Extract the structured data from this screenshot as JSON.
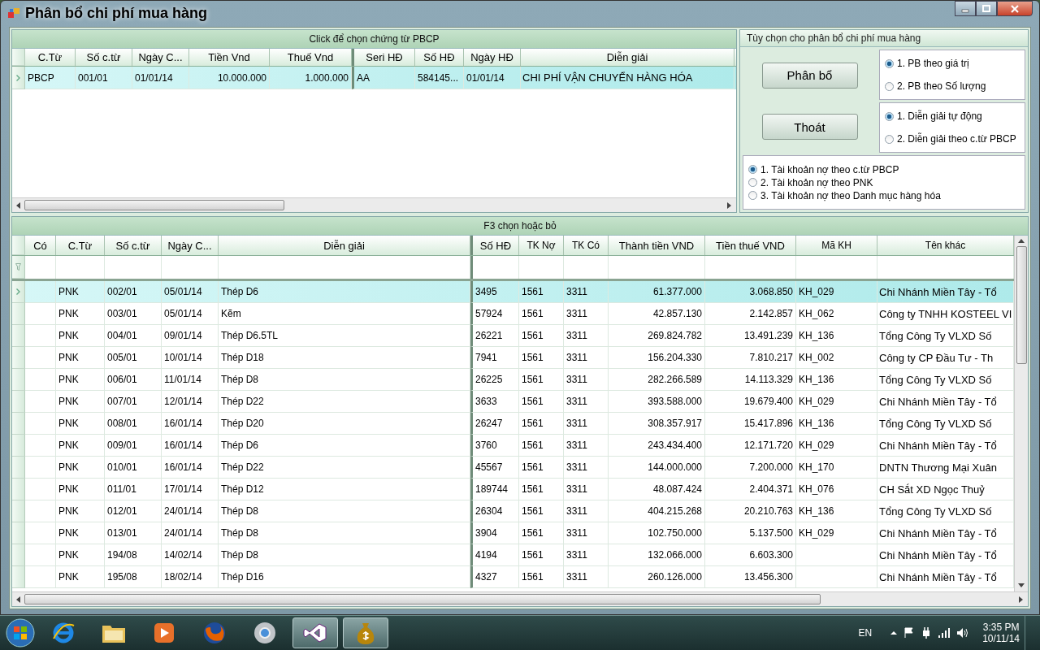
{
  "window": {
    "title": "Phân bổ chi phí mua hàng"
  },
  "top_grid": {
    "caption": "Click để chọn chứng từ PBCP",
    "columns": [
      "C.Từ",
      "Số c.từ",
      "Ngày C...",
      "Tiền Vnd",
      "Thuế Vnd",
      "Seri HĐ",
      "Số HĐ",
      "Ngày HĐ",
      "Diễn giải"
    ],
    "rows": [
      {
        "selected": true,
        "cells": [
          "PBCP",
          "001/01",
          "01/01/14",
          "10.000.000",
          "1.000.000",
          "AA",
          "584145...",
          "01/01/14",
          "CHI PHÍ VẬN CHUYỂN HÀNG HÓA"
        ]
      }
    ]
  },
  "options": {
    "title": "Tùy chọn cho phân bổ chi phí mua hàng",
    "buttons": [
      "Phân bổ",
      "Thoát"
    ],
    "allocation": [
      {
        "label": "1. PB theo giá trị",
        "selected": true
      },
      {
        "label": "2. PB theo Số lượng",
        "selected": false
      }
    ],
    "description": [
      {
        "label": "1. Diễn giải tự động",
        "selected": true
      },
      {
        "label": "2. Diễn giải theo c.từ PBCP",
        "selected": false
      }
    ],
    "debit_account": [
      {
        "label": "1. Tài khoản nợ theo c.từ PBCP",
        "selected": true
      },
      {
        "label": "2. Tài khoản nợ theo PNK",
        "selected": false
      },
      {
        "label": "3. Tài khoản nợ theo Danh mục hàng hóa",
        "selected": false
      }
    ]
  },
  "bottom_grid": {
    "caption": "F3 chọn hoặc bỏ",
    "columns": [
      "Có",
      "C.Từ",
      "Số c.từ",
      "Ngày C...",
      "Diễn giải",
      "Số HĐ",
      "TK Nợ",
      "TK Có",
      "Thành tiền VND",
      "Tiền thuế VND",
      "Mã KH",
      "Tên khác"
    ],
    "rows": [
      {
        "selected": true,
        "cells": [
          null,
          "PNK",
          "002/01",
          "05/01/14",
          "Thép D6",
          "3495",
          "1561",
          "3311",
          "61.377.000",
          "3.068.850",
          "KH_029",
          "Chi Nhánh Miền Tây - Tổ"
        ]
      },
      {
        "selected": false,
        "cells": [
          null,
          "PNK",
          "003/01",
          "05/01/14",
          "Kẽm",
          "57924",
          "1561",
          "3311",
          "42.857.130",
          "2.142.857",
          "KH_062",
          "Công ty TNHH KOSTEEL VI"
        ]
      },
      {
        "selected": false,
        "cells": [
          null,
          "PNK",
          "004/01",
          "09/01/14",
          "Thép D6.5TL",
          "26221",
          "1561",
          "3311",
          "269.824.782",
          "13.491.239",
          "KH_136",
          "Tổng Công Ty VLXD Số"
        ]
      },
      {
        "selected": false,
        "cells": [
          null,
          "PNK",
          "005/01",
          "10/01/14",
          "Thép D18",
          "7941",
          "1561",
          "3311",
          "156.204.330",
          "7.810.217",
          "KH_002",
          "Công ty CP Đầu Tư - Th"
        ]
      },
      {
        "selected": false,
        "cells": [
          null,
          "PNK",
          "006/01",
          "11/01/14",
          "Thép D8",
          "26225",
          "1561",
          "3311",
          "282.266.589",
          "14.113.329",
          "KH_136",
          "Tổng Công Ty VLXD Số"
        ]
      },
      {
        "selected": false,
        "cells": [
          null,
          "PNK",
          "007/01",
          "12/01/14",
          "Thép D22",
          "3633",
          "1561",
          "3311",
          "393.588.000",
          "19.679.400",
          "KH_029",
          "Chi Nhánh Miền Tây - Tổ"
        ]
      },
      {
        "selected": false,
        "cells": [
          null,
          "PNK",
          "008/01",
          "16/01/14",
          "Thép D20",
          "26247",
          "1561",
          "3311",
          "308.357.917",
          "15.417.896",
          "KH_136",
          "Tổng Công Ty VLXD Số"
        ]
      },
      {
        "selected": false,
        "cells": [
          null,
          "PNK",
          "009/01",
          "16/01/14",
          "Thép D6",
          "3760",
          "1561",
          "3311",
          "243.434.400",
          "12.171.720",
          "KH_029",
          "Chi Nhánh Miền Tây - Tổ"
        ]
      },
      {
        "selected": false,
        "cells": [
          null,
          "PNK",
          "010/01",
          "16/01/14",
          "Thép D22",
          "45567",
          "1561",
          "3311",
          "144.000.000",
          "7.200.000",
          "KH_170",
          "DNTN Thương Mại Xuân"
        ]
      },
      {
        "selected": false,
        "cells": [
          null,
          "PNK",
          "011/01",
          "17/01/14",
          "Thép D12",
          "189744",
          "1561",
          "3311",
          "48.087.424",
          "2.404.371",
          "KH_076",
          "CH Sắt XD Ngọc Thuỷ"
        ]
      },
      {
        "selected": false,
        "cells": [
          null,
          "PNK",
          "012/01",
          "24/01/14",
          "Thép D8",
          "26304",
          "1561",
          "3311",
          "404.215.268",
          "20.210.763",
          "KH_136",
          "Tổng Công Ty VLXD Số"
        ]
      },
      {
        "selected": false,
        "cells": [
          null,
          "PNK",
          "013/01",
          "24/01/14",
          "Thép D8",
          "3904",
          "1561",
          "3311",
          "102.750.000",
          "5.137.500",
          "KH_029",
          "Chi Nhánh Miền Tây - Tổ"
        ]
      },
      {
        "selected": false,
        "cells": [
          null,
          "PNK",
          "194/08",
          "14/02/14",
          "Thép D8",
          "4194",
          "1561",
          "3311",
          "132.066.000",
          "6.603.300",
          null,
          "Chi Nhánh Miền Tây - Tổ"
        ]
      },
      {
        "selected": false,
        "cells": [
          null,
          "PNK",
          "195/08",
          "18/02/14",
          "Thép D16",
          "4327",
          "1561",
          "3311",
          "260.126.000",
          "13.456.300",
          null,
          "Chi Nhánh Miền Tây - Tổ"
        ]
      }
    ]
  },
  "taskbar": {
    "apps": [
      {
        "kind": "browser-e",
        "active": false
      },
      {
        "kind": "folder",
        "active": false
      },
      {
        "kind": "media",
        "active": false
      },
      {
        "kind": "fox",
        "active": false
      },
      {
        "kind": "chrome",
        "active": false
      },
      {
        "kind": "studio",
        "active": true
      },
      {
        "kind": "moneybag",
        "active": true
      }
    ],
    "language": "EN",
    "time": "3:35 PM",
    "date": "10/11/14"
  }
}
